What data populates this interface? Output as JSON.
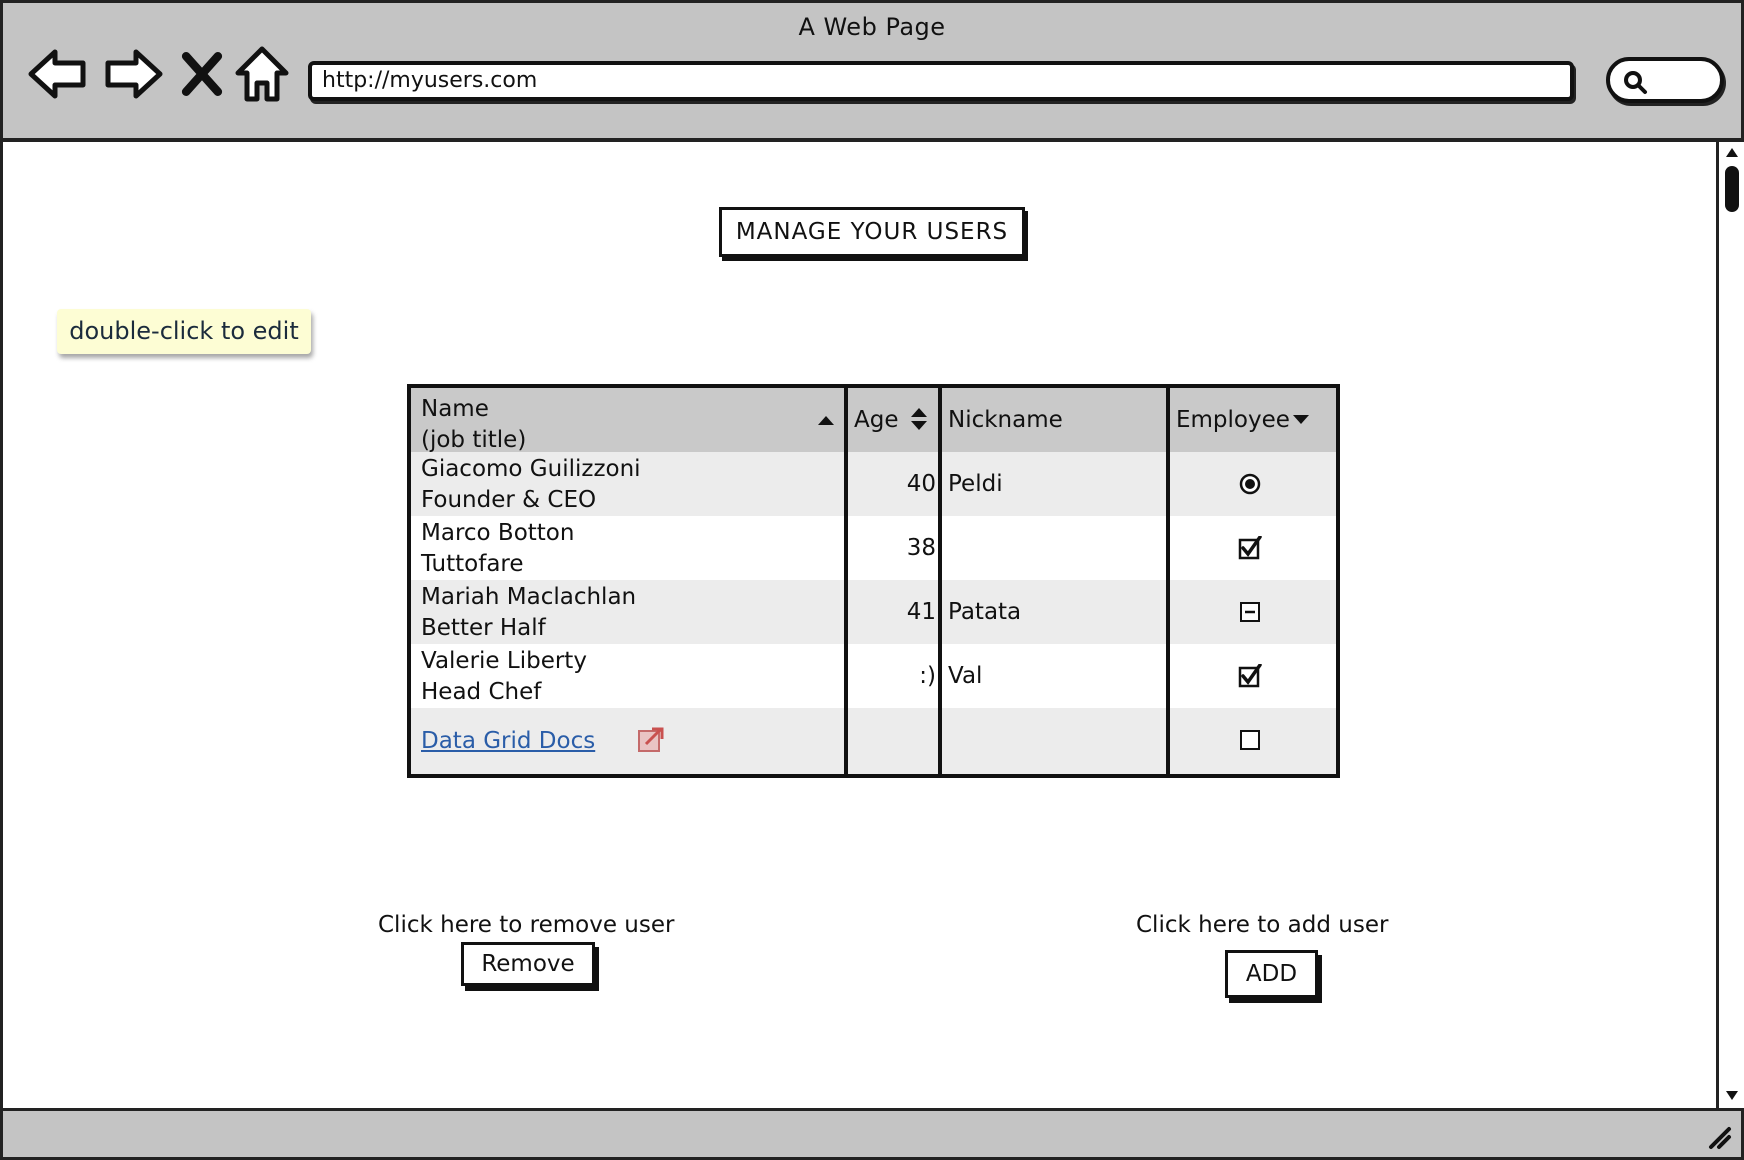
{
  "browser": {
    "title": "A Web Page",
    "url": "http://myusers.com"
  },
  "page": {
    "title": "MANAGE YOUR USERS",
    "tooltip": "double-click to edit"
  },
  "grid": {
    "headers": {
      "name_line1": "Name",
      "name_line2": "(job title)",
      "age": "Age",
      "nickname": "Nickname",
      "employee": "Employee"
    },
    "rows": [
      {
        "name": "Giacomo Guilizzoni",
        "title": "Founder & CEO",
        "age": "40",
        "nickname": "Peldi",
        "employee": "radio-selected"
      },
      {
        "name": "Marco Botton",
        "title": "Tuttofare",
        "age": "38",
        "nickname": "",
        "employee": "checked"
      },
      {
        "name": "Mariah Maclachlan",
        "title": "Better Half",
        "age": "41",
        "nickname": "Patata",
        "employee": "indeterminate"
      },
      {
        "name": "Valerie Liberty",
        "title": "Head Chef",
        "age": ":)",
        "nickname": "Val",
        "employee": "checked"
      }
    ],
    "footer_link": "Data Grid Docs",
    "footer_employee": "unchecked"
  },
  "actions": {
    "remove_caption": "Click here to remove user",
    "remove_label": "Remove",
    "add_caption": "Click here to add user",
    "add_label": "ADD"
  },
  "colors": {
    "chrome": "#c4c4c4",
    "header_bg": "#c9c9c9",
    "row_shade": "#ececec",
    "tooltip_bg": "#fdfdd4",
    "link": "#2a5da8"
  }
}
